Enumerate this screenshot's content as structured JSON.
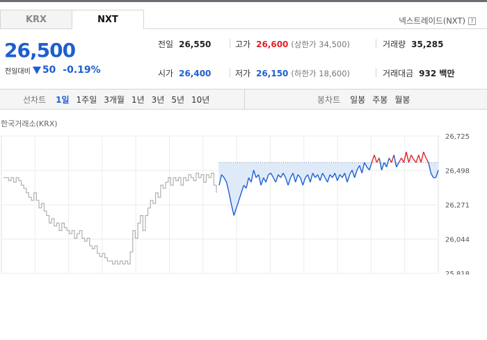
{
  "tabs": [
    {
      "label": "KRX",
      "active": false
    },
    {
      "label": "NXT",
      "active": true
    }
  ],
  "exchange_label": "넥스트레이드(NXT)",
  "help_glyph": "?",
  "price": "26,500",
  "change": {
    "label": "전일대비",
    "arrow": "down",
    "amount": "50",
    "percent": "-0.19%"
  },
  "stats": {
    "prev_close": {
      "label": "전일",
      "value": "26,550"
    },
    "high": {
      "label": "고가",
      "value": "26,600",
      "limit_text": "(상한가 34,500)"
    },
    "volume": {
      "label": "거래량",
      "value": "35,285"
    },
    "open": {
      "label": "시가",
      "value": "26,400"
    },
    "low": {
      "label": "저가",
      "value": "26,150",
      "limit_text": "(하한가 18,600)"
    },
    "amount": {
      "label": "거래대금",
      "value": "932 백만"
    }
  },
  "toolbar": {
    "line_chart_label": "선차트",
    "line_periods": [
      "1일",
      "1주일",
      "3개월",
      "1년",
      "3년",
      "5년",
      "10년"
    ],
    "selected_period": "1일",
    "candle_chart_label": "봉차트",
    "candle_periods": [
      "일봉",
      "주봉",
      "월봉"
    ]
  },
  "market_label": "한국거래소(KRX)",
  "colors": {
    "up": "#e0222a",
    "down": "#1d5fd0",
    "inactive": "#b0b0b0"
  },
  "chart_data": {
    "type": "line",
    "title": "",
    "xlabel": "",
    "ylabel": "",
    "y_ticks": [
      26725,
      26498,
      26271,
      26044,
      25818
    ],
    "y_tick_labels": [
      "26,725",
      "26,498",
      "26,271",
      "26,044",
      "25,818"
    ],
    "ylim": [
      25818,
      26725
    ],
    "baseline": 26550,
    "grid": true,
    "series": [
      {
        "segment": "KRX",
        "color": "#b0b0b0",
        "values": [
          26450,
          26450,
          26430,
          26450,
          26420,
          26450,
          26430,
          26400,
          26380,
          26350,
          26320,
          26300,
          26350,
          26300,
          26250,
          26280,
          26230,
          26200,
          26150,
          26180,
          26130,
          26150,
          26100,
          26150,
          26120,
          26100,
          26080,
          26100,
          26050,
          26080,
          26100,
          26050,
          26030,
          26050,
          26000,
          25980,
          26000,
          25950,
          25930,
          25950,
          25920,
          25900,
          25900,
          25880,
          25900,
          25880,
          25900,
          25880,
          25900,
          25880,
          25960,
          26100,
          26050,
          26150,
          26200,
          26100,
          26200,
          26250,
          26300,
          26280,
          26350,
          26320,
          26400,
          26380,
          26420,
          26450,
          26400,
          26450,
          26430,
          26450,
          26400,
          26450,
          26430,
          26470,
          26450,
          26430,
          26480,
          26450,
          26470,
          26420,
          26470,
          26450,
          26480,
          26400,
          26350
        ]
      },
      {
        "segment": "NXT",
        "color": "#1d5fd0",
        "values": [
          26400,
          26470,
          26450,
          26420,
          26350,
          26270,
          26200,
          26250,
          26300,
          26350,
          26400,
          26380,
          26450,
          26420,
          26500,
          26450,
          26470,
          26400,
          26450,
          26420,
          26470,
          26480,
          26450,
          26420,
          26470,
          26450,
          26480,
          26450,
          26400,
          26450,
          26480,
          26420,
          26470,
          26450,
          26400,
          26450,
          26470,
          26420,
          26480,
          26450,
          26470,
          26430,
          26480,
          26450,
          26420,
          26470,
          26450,
          26480,
          26430,
          26470,
          26450,
          26480,
          26420,
          26470,
          26500,
          26450,
          26500,
          26530,
          26480,
          26550,
          26520,
          26500,
          26550,
          26600,
          26550,
          26580,
          26500,
          26550,
          26520,
          26580,
          26550,
          26600,
          26520,
          26550,
          26580,
          26550,
          26620,
          26550,
          26600,
          26570,
          26550,
          26600,
          26550,
          26620,
          26580,
          26550,
          26480,
          26450,
          26450,
          26500
        ]
      }
    ]
  }
}
